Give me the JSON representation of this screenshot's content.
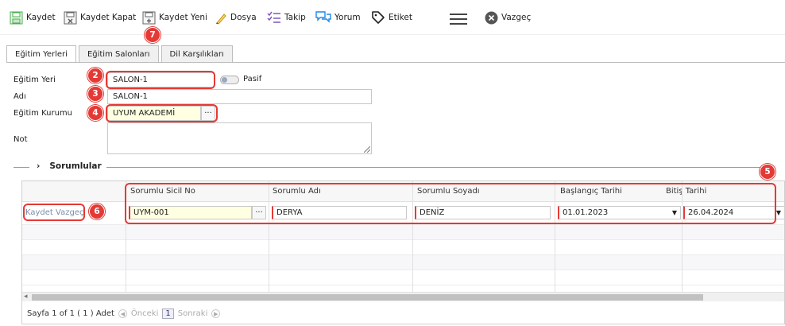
{
  "toolbar": {
    "save": "Kaydet",
    "save_close": "Kaydet Kapat",
    "save_new": "Kaydet Yeni",
    "file": "Dosya",
    "follow": "Takip",
    "comment": "Yorum",
    "tag": "Etiket",
    "cancel": "Vazgeç"
  },
  "tabs": [
    "Eğitim Yerleri",
    "Eğitim Salonları",
    "Dil Karşılıkları"
  ],
  "form": {
    "place_label": "Eğitim Yeri",
    "place_value": "SALON-1",
    "passive_label": "Pasif",
    "name_label": "Adı",
    "name_value": "SALON-1",
    "institution_label": "Eğitim Kurumu",
    "institution_value": "UYUM AKADEMİ",
    "note_label": "Not",
    "ellipsis": "···"
  },
  "section": {
    "title": "Sorumlular",
    "arrow": "›"
  },
  "grid": {
    "columns": [
      "Sorumlu Sicil No",
      "Sorumlu Adı",
      "Sorumlu Soyadı",
      "Başlangıç Tarihi",
      "Bitiş Tarihi"
    ],
    "edit_save": "Kaydet",
    "edit_cancel": "Vazgeç",
    "row": {
      "sicil": "UYM-001",
      "name": "DERYA",
      "surname": "DENİZ",
      "start": "01.01.2023",
      "end": "26.04.2024"
    },
    "pager": {
      "info": "Sayfa 1 of 1 ( 1 ) Adet",
      "prev": "Önceki",
      "page": "1",
      "next": "Sonraki"
    }
  },
  "badges": [
    "2",
    "3",
    "4",
    "5",
    "6",
    "7"
  ],
  "colors": {
    "badge": "#e53935",
    "required_field": "#ffffe1"
  }
}
